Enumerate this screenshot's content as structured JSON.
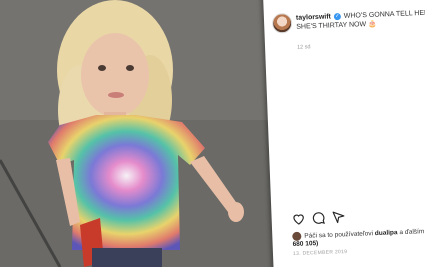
{
  "post": {
    "username": "taylorswift",
    "caption": "WHO'S GONNA TELL HER SHE'S THIRTAY NOW",
    "caption_emoji": "🎂",
    "time_ago": "12 sd",
    "liked_prefix": "Páči sa to používateľovi",
    "liked_user": "dualipa",
    "liked_suffix": " a ďalším",
    "liked_count": "(2 680 105)",
    "date": "13. DECEMBER 2019"
  },
  "icons": {
    "like": "heart-icon",
    "comment": "comment-icon",
    "share": "share-icon",
    "verified": "verified-badge-icon"
  },
  "colors": {
    "verified_blue": "#3897f0",
    "panel_bg": "#ffffff"
  }
}
